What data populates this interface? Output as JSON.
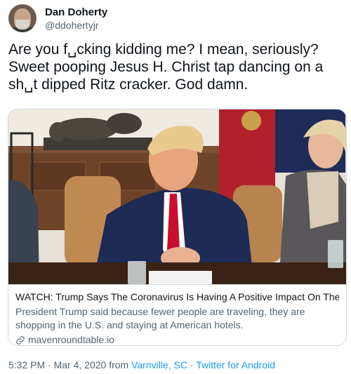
{
  "author": {
    "display_name": "Dan Doherty",
    "handle": "@ddohertyjr"
  },
  "tweet": {
    "text": "Are you f␣cking kidding me? I mean, seriously? Sweet pooping Jesus H. Christ tap dancing on a sh␣t dipped Ritz cracker. God damn."
  },
  "card": {
    "title": "WATCH: Trump Says The Coronavirus Is Having A Positive Impact On The Cou...",
    "description": "President Trump said because fewer people are traveling, they are shopping in the U.S. and staying at American hotels.",
    "domain": "mavenroundtable.io",
    "image_icon": "link-icon"
  },
  "footer": {
    "time": "5:32 PM",
    "sep1": " · ",
    "date": "Mar 4, 2020",
    "from": " from ",
    "location": "Varnville, SC",
    "sep2": " · ",
    "source": "Twitter for Android"
  },
  "colors": {
    "link": "#1d9bf0",
    "secondary_text": "#536471",
    "border": "#cfd9de"
  }
}
